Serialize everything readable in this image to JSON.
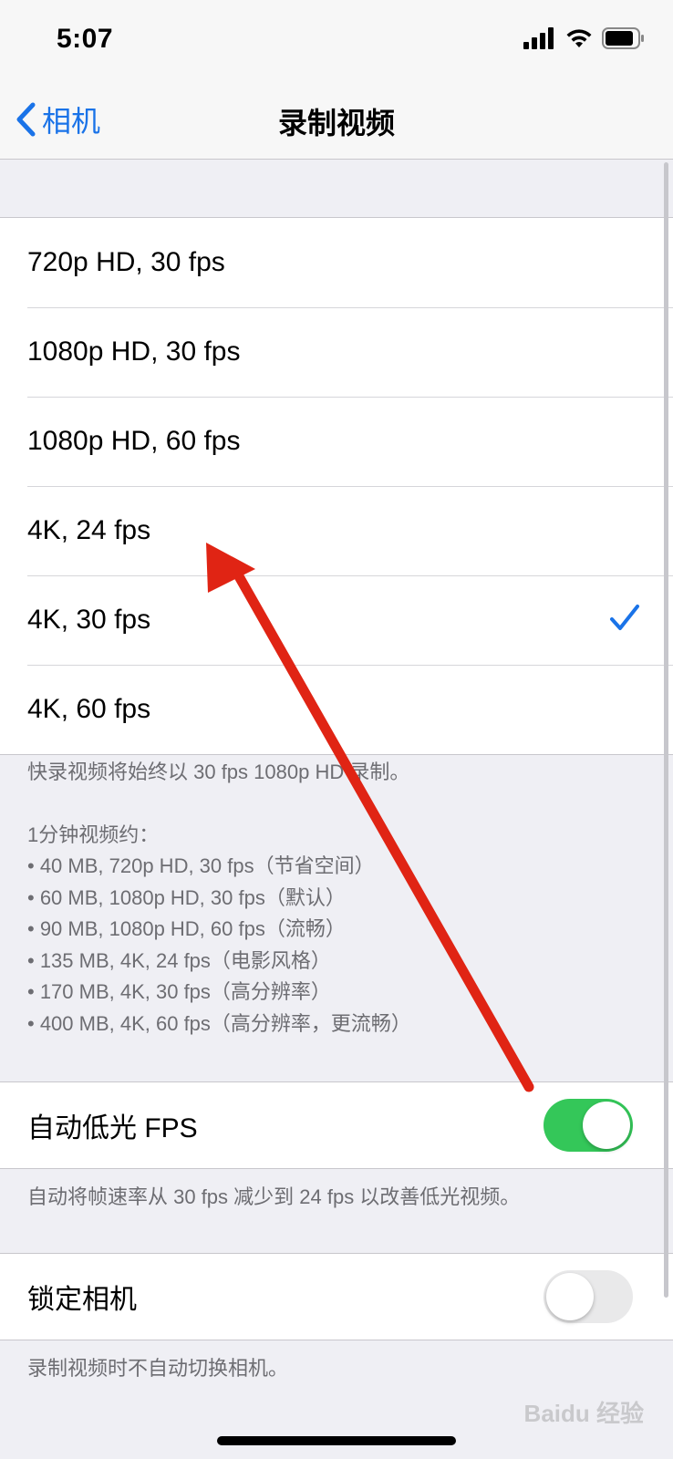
{
  "status_bar": {
    "time": "5:07"
  },
  "nav": {
    "back_label": "相机",
    "title": "录制视频"
  },
  "resolutions": [
    {
      "label": "720p HD, 30 fps",
      "selected": false
    },
    {
      "label": "1080p HD, 30 fps",
      "selected": false
    },
    {
      "label": "1080p HD, 60 fps",
      "selected": false
    },
    {
      "label": "4K, 24 fps",
      "selected": false
    },
    {
      "label": "4K, 30 fps",
      "selected": true
    },
    {
      "label": "4K, 60 fps",
      "selected": false
    }
  ],
  "resolution_footer": {
    "note": "快录视频将始终以 30 fps 1080p HD 录制。",
    "heading": "1分钟视频约：",
    "items": [
      "• 40 MB, 720p HD, 30 fps（节省空间）",
      "• 60 MB, 1080p HD, 30 fps（默认）",
      "• 90 MB, 1080p HD, 60 fps（流畅）",
      "• 135 MB, 4K, 24 fps（电影风格）",
      "• 170 MB, 4K, 30 fps（高分辨率）",
      "• 400 MB, 4K, 60 fps（高分辨率，更流畅）"
    ]
  },
  "auto_low_light": {
    "label": "自动低光 FPS",
    "on": true,
    "footer": "自动将帧速率从 30 fps 减少到 24 fps 以改善低光视频。"
  },
  "lock_camera": {
    "label": "锁定相机",
    "on": false,
    "footer": "录制视频时不自动切换相机。"
  },
  "watermark": "Baidu 经验",
  "colors": {
    "accent": "#1a73e8",
    "toggle_on": "#34c759",
    "annotation_arrow": "#e02414"
  }
}
